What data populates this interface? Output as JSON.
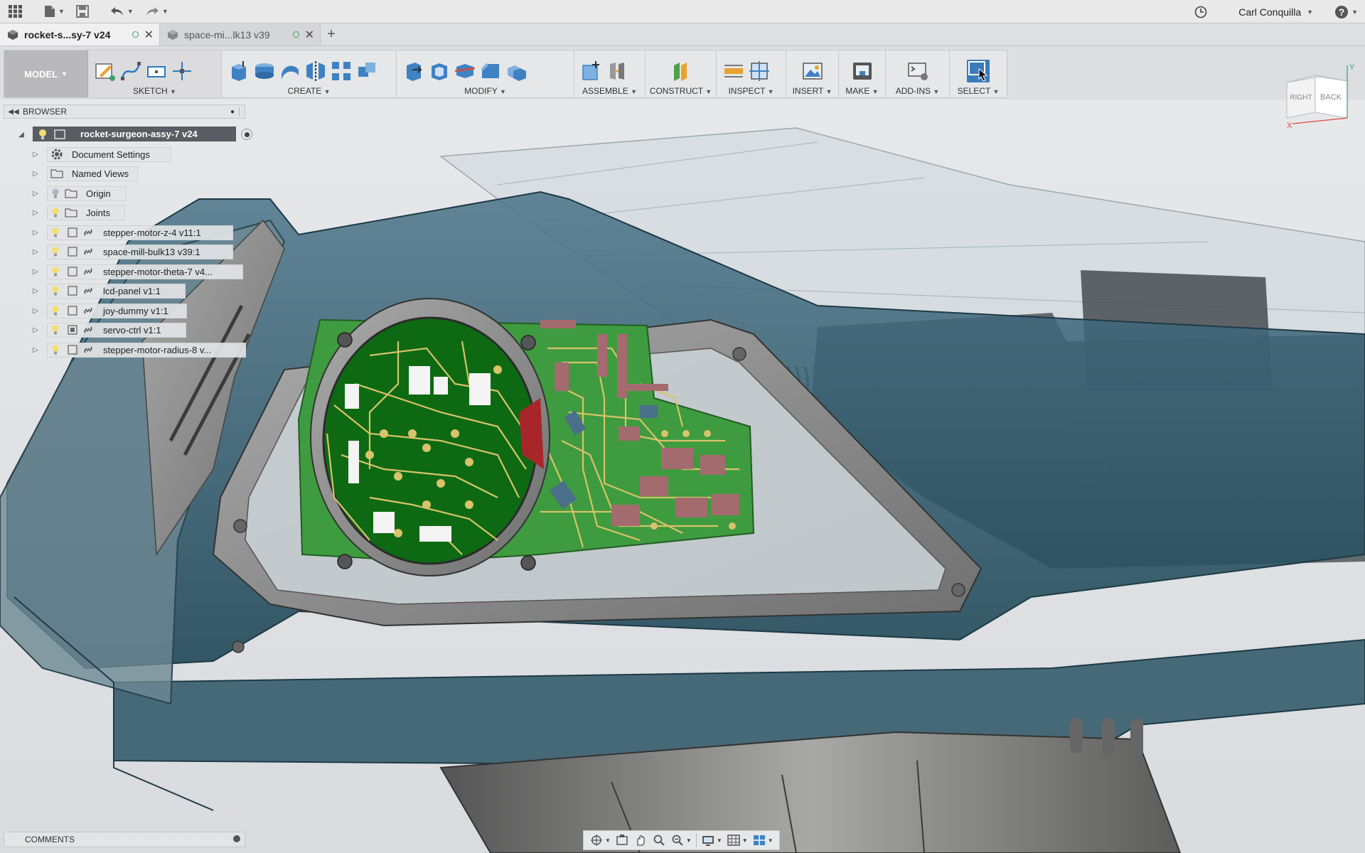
{
  "topbar": {
    "icons": [
      "apps-grid-icon",
      "file-icon",
      "save-icon",
      "undo-icon",
      "redo-icon"
    ],
    "user_name": "Carl Conquilla",
    "right_icons": [
      "job-status-clock-icon",
      "help-icon"
    ]
  },
  "tabs": [
    {
      "label": "rocket-s...sy-7 v24",
      "active": true
    },
    {
      "label": "space-mi...lk13 v39",
      "active": false
    }
  ],
  "toolbar": {
    "workspace": "MODEL",
    "groups": [
      {
        "label": "SKETCH",
        "icons": [
          "create-sketch-icon",
          "spline-icon",
          "rectangle-icon",
          "point-icon"
        ]
      },
      {
        "label": "CREATE",
        "icons": [
          "extrude-icon",
          "revolve-icon",
          "sweep-icon",
          "mirror-icon",
          "pattern-icon",
          "combine-icon"
        ]
      },
      {
        "label": "MODIFY",
        "icons": [
          "press-pull-icon",
          "shell-icon",
          "split-body-icon",
          "chamfer-icon",
          "move-icon"
        ]
      },
      {
        "label": "ASSEMBLE",
        "icons": [
          "new-component-icon",
          "joint-icon"
        ]
      },
      {
        "label": "CONSTRUCT",
        "icons": [
          "offset-plane-icon"
        ]
      },
      {
        "label": "INSPECT",
        "icons": [
          "measure-icon",
          "section-analysis-icon"
        ]
      },
      {
        "label": "INSERT",
        "icons": [
          "insert-image-icon"
        ]
      },
      {
        "label": "MAKE",
        "icons": [
          "3d-print-icon"
        ]
      },
      {
        "label": "ADD-INS",
        "icons": [
          "scripts-icon"
        ]
      },
      {
        "label": "SELECT",
        "icons": [
          "select-icon"
        ]
      }
    ]
  },
  "viewcube": {
    "right": "RIGHT",
    "back": "BACK",
    "y_axis": "Y",
    "x_axis": "X"
  },
  "browser": {
    "title": "BROWSER",
    "root": "rocket-surgeon-assy-7 v24",
    "items": [
      {
        "label": "Document Settings",
        "icon": "gear-icon"
      },
      {
        "label": "Named Views",
        "icon": "folder-icon"
      },
      {
        "label": "Origin",
        "icon": "folder-icon"
      },
      {
        "label": "Joints",
        "icon": "folder-icon"
      },
      {
        "label": "stepper-motor-z-4 v11:1",
        "icon": "component-icon"
      },
      {
        "label": "space-mill-bulk13 v39:1",
        "icon": "component-icon"
      },
      {
        "label": "stepper-motor-theta-7 v4...",
        "icon": "component-icon"
      },
      {
        "label": "lcd-panel v1:1",
        "icon": "component-icon"
      },
      {
        "label": "joy-dummy v1:1",
        "icon": "component-icon"
      },
      {
        "label": "servo-ctrl v1:1",
        "icon": "component-icon"
      },
      {
        "label": "stepper-motor-radius-8 v...",
        "icon": "component-icon"
      }
    ]
  },
  "comments": {
    "title": "COMMENTS"
  },
  "navbar": {
    "icons": [
      "orbit-icon",
      "look-at-icon",
      "pan-icon",
      "zoom-icon",
      "fit-icon",
      "display-settings-icon",
      "grid-icon",
      "viewports-icon"
    ]
  },
  "colors": {
    "accent": "#3a7bbd",
    "pcb_green": "#2e8b2e",
    "shell_teal": "#2f5a6c",
    "metal_grey": "#8e8f8f"
  }
}
